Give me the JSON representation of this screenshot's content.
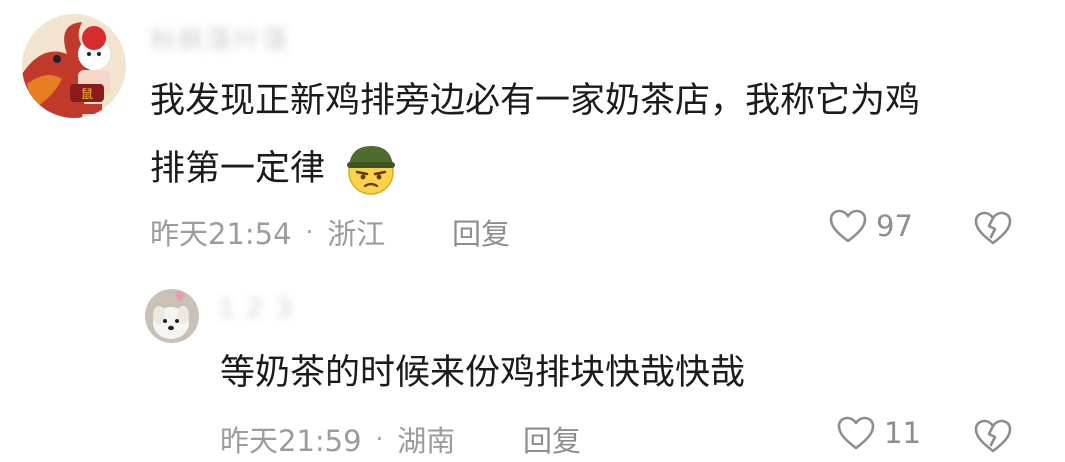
{
  "comments": [
    {
      "username": "秋枫落叶落",
      "text_line1": "我发现正新鸡排旁边必有一家奶茶店，我称它为鸡",
      "text_line2": "排第一定律",
      "emoji": "grimacing-soldier-emoji",
      "time": "昨天21:54",
      "separator": "·",
      "location": "浙江",
      "reply_label": "回复",
      "likes": "97",
      "avatar": "dragon-cartoon-avatar"
    },
    {
      "username": "1 2 3",
      "text": "等奶茶的时候来份鸡排块快哉快哉",
      "time": "昨天21:59",
      "separator": "·",
      "location": "湖南",
      "reply_label": "回复",
      "likes": "11",
      "avatar": "white-dog-avatar"
    }
  ],
  "icons": {
    "like": "heart-outline-icon",
    "dislike": "broken-heart-outline-icon"
  },
  "colors": {
    "text": "#1b1b1b",
    "meta": "#9c9c9c",
    "icon": "#8e8e8e",
    "background": "#ffffff"
  }
}
